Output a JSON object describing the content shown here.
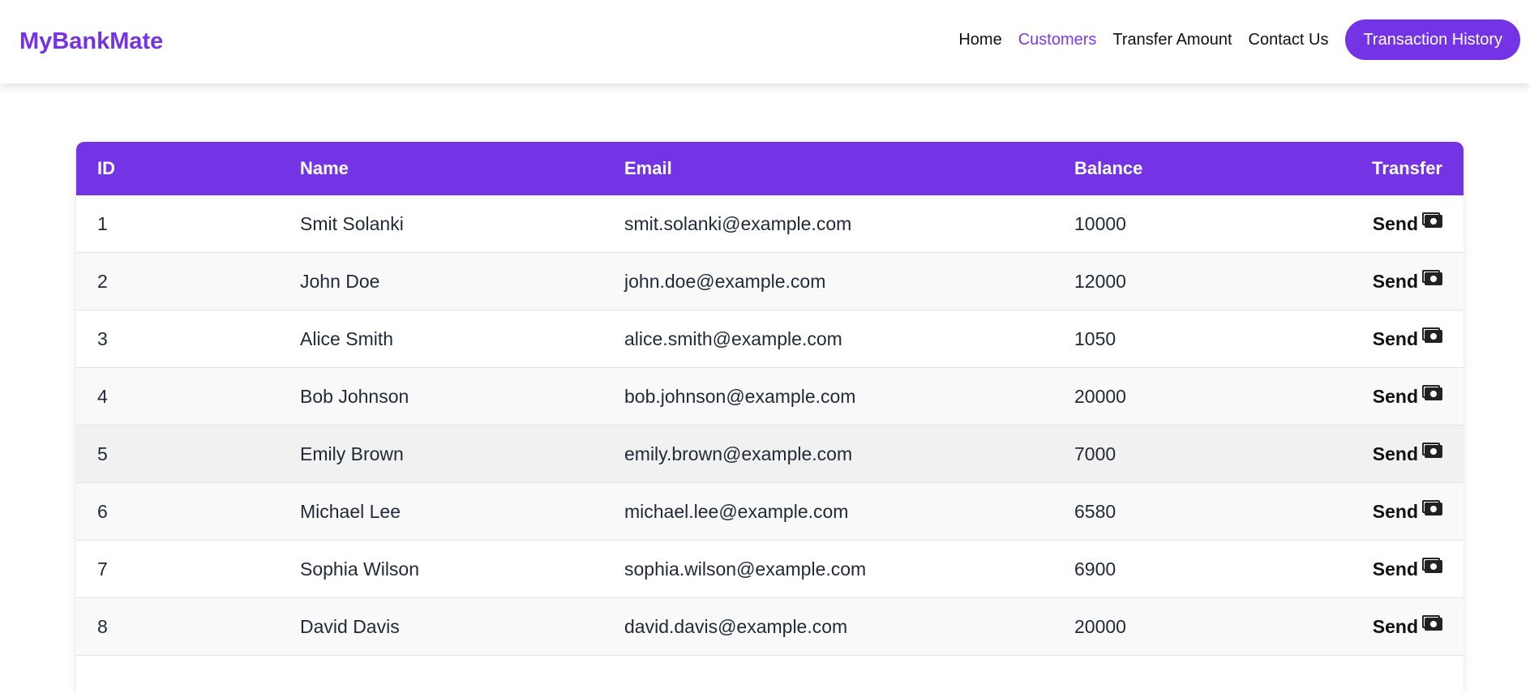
{
  "brand": "MyBankMate",
  "nav": {
    "links": [
      {
        "label": "Home",
        "active": false
      },
      {
        "label": "Customers",
        "active": true
      },
      {
        "label": "Transfer Amount",
        "active": false
      },
      {
        "label": "Contact Us",
        "active": false
      }
    ],
    "cta": "Transaction History"
  },
  "colors": {
    "accent": "#7433e4",
    "active_link": "#7d3be8"
  },
  "table": {
    "headers": [
      "ID",
      "Name",
      "Email",
      "Balance",
      "Transfer"
    ],
    "rows": [
      {
        "id": "1",
        "name": "Smit Solanki",
        "email": "smit.solanki@example.com",
        "balance": "10000",
        "action": "Send",
        "icon": "money-icon"
      },
      {
        "id": "2",
        "name": "John Doe",
        "email": "john.doe@example.com",
        "balance": "12000",
        "action": "Send",
        "icon": "money-icon"
      },
      {
        "id": "3",
        "name": "Alice Smith",
        "email": "alice.smith@example.com",
        "balance": "1050",
        "action": "Send",
        "icon": "money-icon"
      },
      {
        "id": "4",
        "name": "Bob Johnson",
        "email": "bob.johnson@example.com",
        "balance": "20000",
        "action": "Send",
        "icon": "money-icon"
      },
      {
        "id": "5",
        "name": "Emily Brown",
        "email": "emily.brown@example.com",
        "balance": "7000",
        "action": "Send",
        "icon": "money-icon"
      },
      {
        "id": "6",
        "name": "Michael Lee",
        "email": "michael.lee@example.com",
        "balance": "6580",
        "action": "Send",
        "icon": "money-icon"
      },
      {
        "id": "7",
        "name": "Sophia Wilson",
        "email": "sophia.wilson@example.com",
        "balance": "6900",
        "action": "Send",
        "icon": "money-icon"
      },
      {
        "id": "8",
        "name": "David Davis",
        "email": "david.davis@example.com",
        "balance": "20000",
        "action": "Send",
        "icon": "money-icon"
      }
    ]
  }
}
